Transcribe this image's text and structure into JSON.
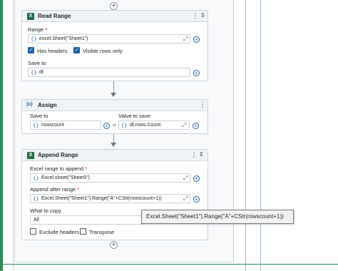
{
  "read_range": {
    "title": "Read Range",
    "range_label": "Range",
    "required_mark": "*",
    "range_value": "excel.Sheet(\"Sheet1\")",
    "has_headers": {
      "label": "Has headers",
      "checked": true
    },
    "visible_rows": {
      "label": "Visible rows only",
      "checked": true
    },
    "save_to_label": "Save to",
    "save_to_value": "dt"
  },
  "assign": {
    "title": "Assign",
    "icon_text": "(x)",
    "save_to_label": "Save to",
    "save_to_value": "rowscount",
    "equals": "=",
    "value_label": "Value to save",
    "value_value": "dt.rows.Count"
  },
  "append_range": {
    "title": "Append Range",
    "excel_range_label": "Excel range to append",
    "excel_range_value": "Excel.sheet(\"Sheet3\")",
    "after_range_label": "Append after range",
    "after_range_value": "Excel.Sheet(\"Sheet1\").Range(\"A\"+CStr(rowscount+1))",
    "what_to_copy_label": "What to copy",
    "what_to_copy_value": "All",
    "exclude_headers": {
      "label": "Exclude headers",
      "checked": false
    },
    "transpose": {
      "label": "Transpose",
      "checked": false
    }
  },
  "tooltip": {
    "text": "Excel.Sheet(\"Sheet1\").Range(\"A\"+CStr(rowscount+1))"
  },
  "icons": {
    "braces": "{}",
    "add": "+",
    "kebab": "⋮",
    "collapse": "⇕",
    "expand": "⤢",
    "check": "✓",
    "excel": "X"
  },
  "colors": {
    "accent": "#1f5fa8",
    "excel_green": "#1d6f42",
    "header_bg": "#eef3f8"
  }
}
